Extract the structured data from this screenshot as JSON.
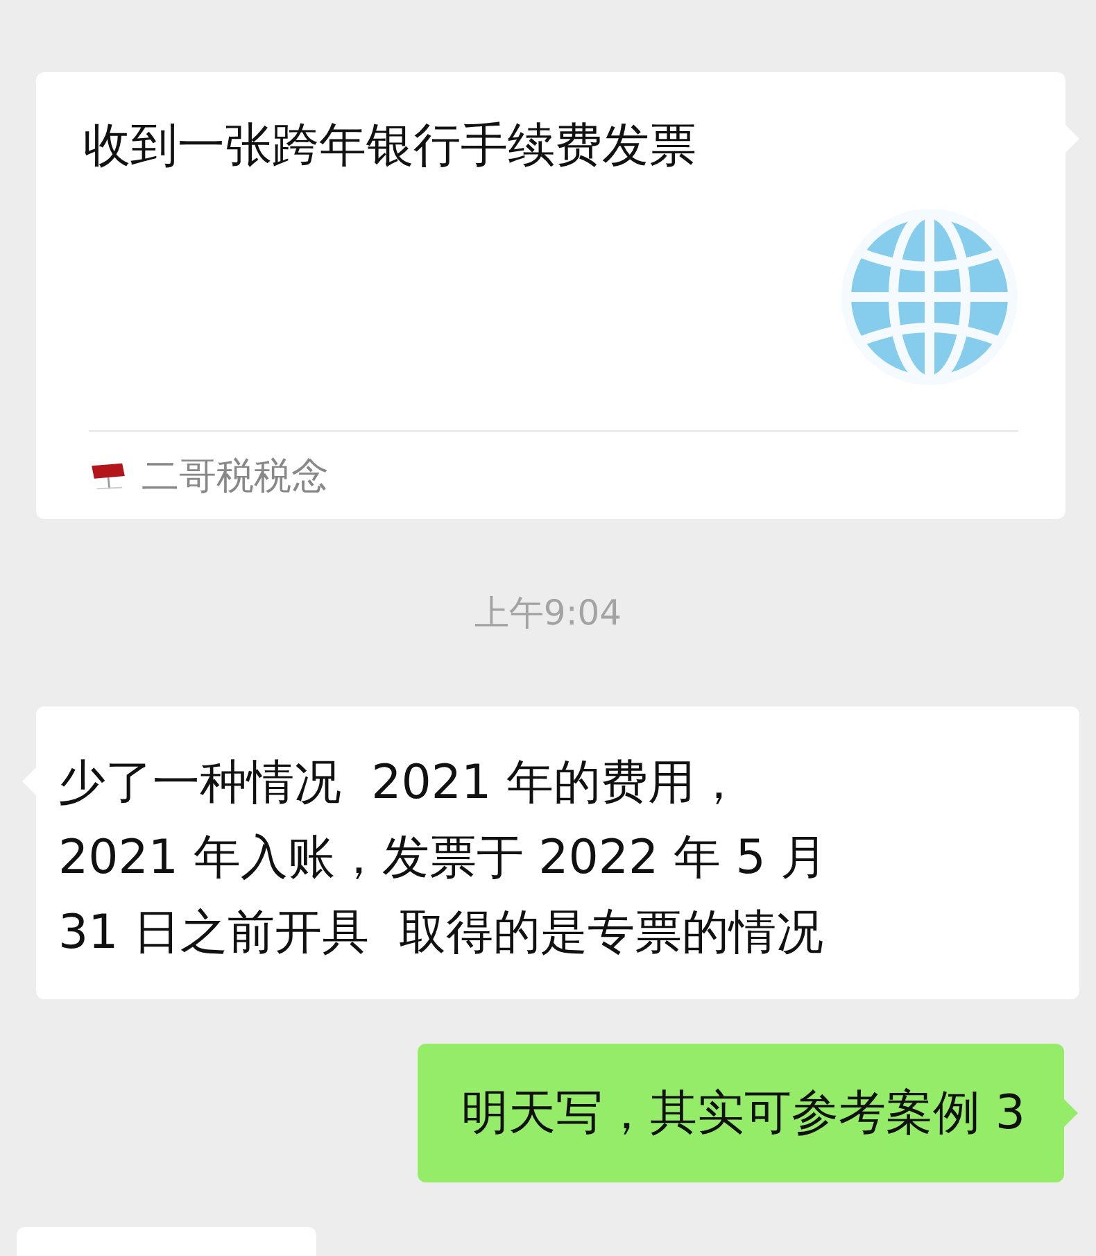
{
  "messages": [
    {
      "kind": "sent_link_card",
      "title": "收到一张跨年银行手续费发票",
      "source": "二哥税税念"
    },
    {
      "kind": "time",
      "text": "上午9:04"
    },
    {
      "kind": "received_text",
      "text": "少了一种情况  2021 年的费用，\n2021 年入账，发票于 2022 年 5 月\n31 日之前开具  取得的是专票的情况"
    },
    {
      "kind": "sent_text",
      "text": "明天写，其实可参考案例 3"
    },
    {
      "kind": "received_partial"
    }
  ]
}
